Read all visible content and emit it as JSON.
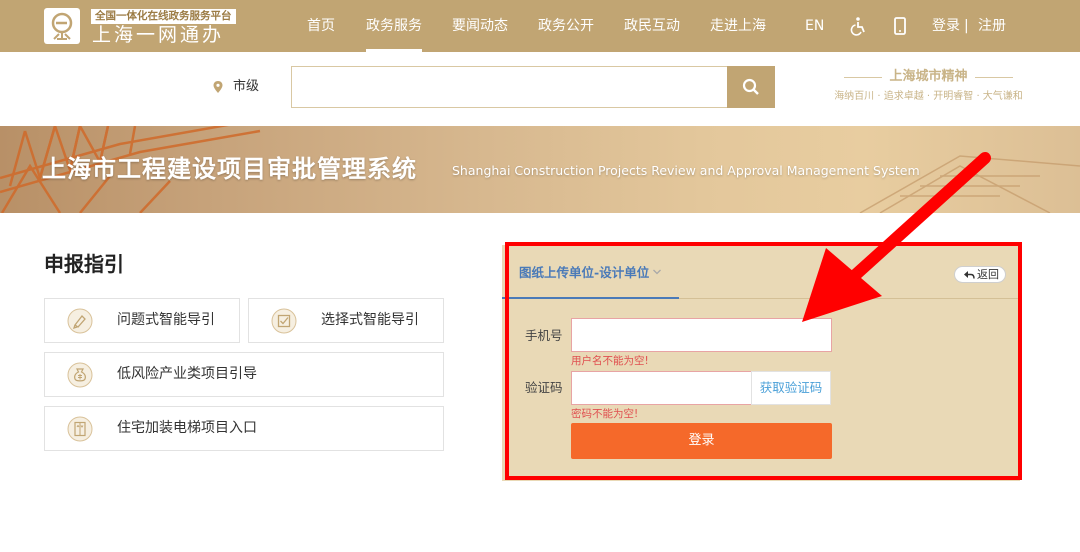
{
  "header": {
    "logo_tagline": "全国一体化在线政务服务平台",
    "logo_name": "上海一网通办",
    "nav": [
      {
        "label": "首页",
        "active": false
      },
      {
        "label": "政务服务",
        "active": true
      },
      {
        "label": "要闻动态",
        "active": false
      },
      {
        "label": "政务公开",
        "active": false
      },
      {
        "label": "政民互动",
        "active": false
      },
      {
        "label": "走进上海",
        "active": false
      }
    ],
    "lang_label": "EN",
    "login_label": "登录",
    "divider": "|",
    "register_label": "注册"
  },
  "search": {
    "location": "市级",
    "value": "",
    "placeholder": ""
  },
  "spirit": {
    "title": "上海城市精神",
    "subtitle": "海纳百川 · 追求卓越 · 开明睿智 · 大气谦和"
  },
  "banner": {
    "title": "上海市工程建设项目审批管理系统",
    "subtitle": "Shanghai Construction Projects Review and Approval Management System"
  },
  "guide": {
    "title": "申报指引",
    "items": [
      {
        "label": "问题式智能导引",
        "icon": "pen-icon"
      },
      {
        "label": "选择式智能导引",
        "icon": "checkbox-icon"
      },
      {
        "label": "低风险产业类项目引导",
        "icon": "money-bag-icon"
      },
      {
        "label": "住宅加装电梯项目入口",
        "icon": "elevator-icon"
      }
    ]
  },
  "login": {
    "tab_label": "图纸上传单位-设计单位",
    "back_label": "返回",
    "phone_label": "手机号",
    "phone_value": "",
    "phone_error": "用户名不能为空!",
    "code_label": "验证码",
    "code_value": "",
    "code_error": "密码不能为空!",
    "get_code_label": "获取验证码",
    "submit_label": "登录"
  },
  "colors": {
    "brand": "#c1a573",
    "panel": "#e9d9b6",
    "tab_accent": "#4a7ab8",
    "submit": "#f5692a",
    "error": "#e05050",
    "annotation": "#ff0000"
  }
}
